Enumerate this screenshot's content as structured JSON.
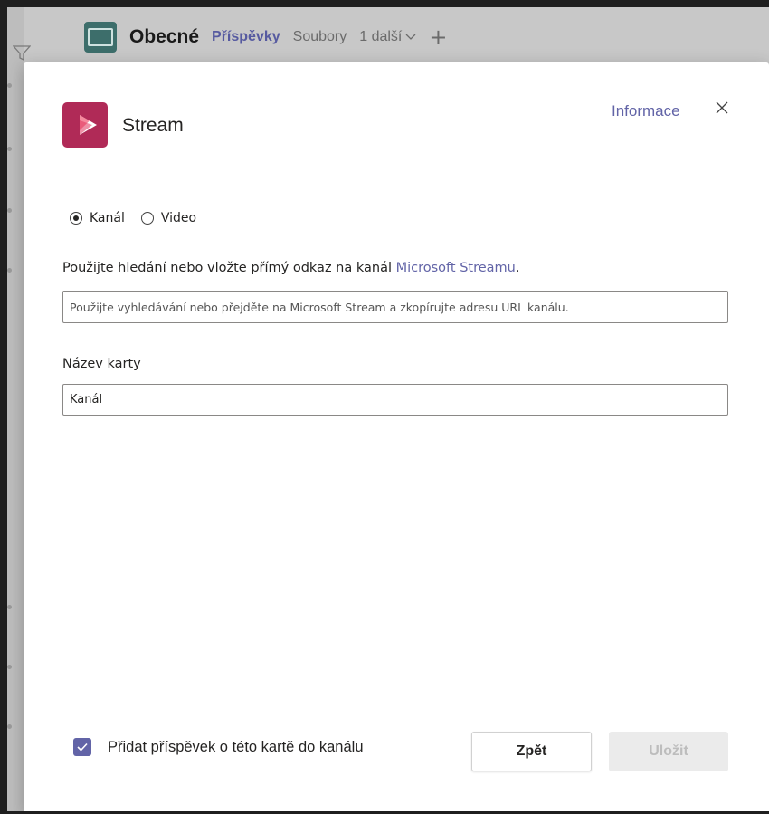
{
  "background": {
    "channel_name": "Obecné",
    "tabs": [
      {
        "label": "Příspěvky"
      },
      {
        "label": "Soubory"
      }
    ],
    "more_tabs_label": "1 další"
  },
  "dialog": {
    "app_name": "Stream",
    "info_link": "Informace",
    "radios": [
      {
        "label": "Kanál",
        "selected": true
      },
      {
        "label": "Video",
        "selected": false
      }
    ],
    "description": {
      "text": "Použijte hledání nebo vložte přímý odkaz na kanál ",
      "link": "Microsoft Streamu",
      "suffix": "."
    },
    "url_input": {
      "value": "",
      "placeholder": "Použijte vyhledávání nebo přejděte na Microsoft Stream a zkopírujte adresu URL kanálu."
    },
    "tab_name": {
      "label": "Název karty",
      "value": "Kanál"
    },
    "post_checkbox": {
      "label": "Přidat příspěvek o této kartě do kanálu",
      "checked": true
    },
    "buttons": {
      "back": "Zpět",
      "save": "Uložit"
    }
  },
  "colors": {
    "accent": "#6264a7",
    "stream_brand": "#b02a57",
    "disabled_bg": "#ebebeb"
  }
}
